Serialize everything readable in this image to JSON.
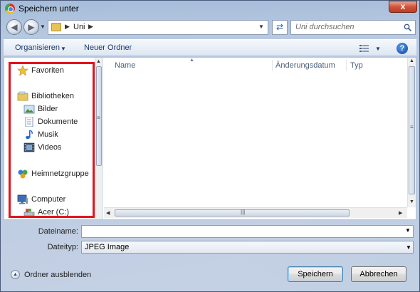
{
  "window": {
    "title": "Speichern unter",
    "close_label": "x"
  },
  "address": {
    "back_icon": "back-arrow-icon",
    "forward_icon": "forward-arrow-icon",
    "crumbs": [
      "Uni"
    ],
    "search_placeholder": "Uni durchsuchen"
  },
  "toolbar": {
    "organize_label": "Organisieren",
    "new_folder_label": "Neuer Ordner"
  },
  "nav_pane": {
    "items": [
      {
        "label": "Favoriten",
        "icon": "star-icon"
      },
      {
        "label": "Bibliotheken",
        "icon": "libraries-icon"
      },
      {
        "label": "Bilder",
        "icon": "pictures-icon"
      },
      {
        "label": "Dokumente",
        "icon": "documents-icon"
      },
      {
        "label": "Musik",
        "icon": "music-icon"
      },
      {
        "label": "Videos",
        "icon": "videos-icon"
      },
      {
        "label": "Heimnetzgruppe",
        "icon": "homegroup-icon"
      },
      {
        "label": "Computer",
        "icon": "computer-icon"
      },
      {
        "label": "Acer (C:)",
        "icon": "drive-icon"
      }
    ],
    "highlight_color": "#e2141e"
  },
  "file_list": {
    "columns": [
      "Name",
      "Änderungsdatum",
      "Typ"
    ],
    "rows": []
  },
  "form": {
    "filename_label": "Dateiname:",
    "filename_value": "",
    "filetype_label": "Dateityp:",
    "filetype_value": "JPEG Image"
  },
  "footer": {
    "hide_folders_label": "Ordner ausblenden",
    "save_label": "Speichern",
    "cancel_label": "Abbrechen"
  }
}
